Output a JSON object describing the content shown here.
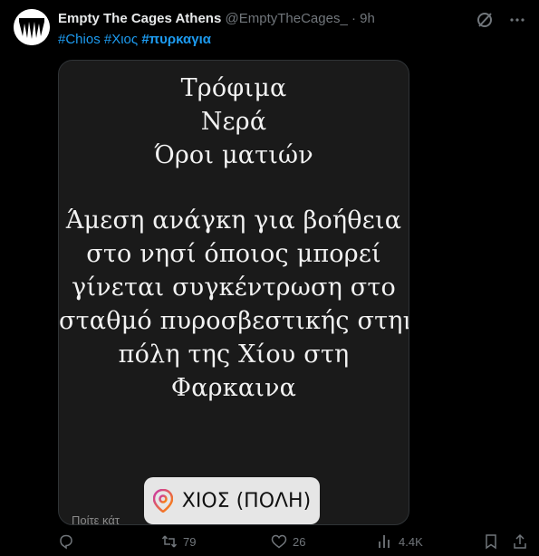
{
  "tweet": {
    "author_name": "Empty The Cages Athens",
    "handle": "@EmptyTheCages_",
    "separator": "·",
    "time": "9h",
    "hashtags": [
      "#Chios",
      "#Χιος",
      "#πυρκαγια"
    ]
  },
  "media": {
    "lines_top": [
      "Τρόφιμα",
      "Νερά",
      "Όροι ματιών"
    ],
    "lines_body": [
      "Άμεση ανάγκη για βοήθεια",
      "στο νησί όποιος μπορεί",
      "γίνεται συγκέντρωση στο",
      "σταθμό πυροσβεστικής στην",
      "πόλη της Χίου στη",
      "Φαρκαινα"
    ],
    "location": "ΧΙΟΣ (ΠΟΛΗ)",
    "cut_text": "Ποίτε κάτ"
  },
  "actions": {
    "retweets": "79",
    "likes": "26",
    "views": "4.4K"
  },
  "colors": {
    "accent": "#1d9bf0",
    "muted": "#71767b",
    "background": "#000000"
  }
}
